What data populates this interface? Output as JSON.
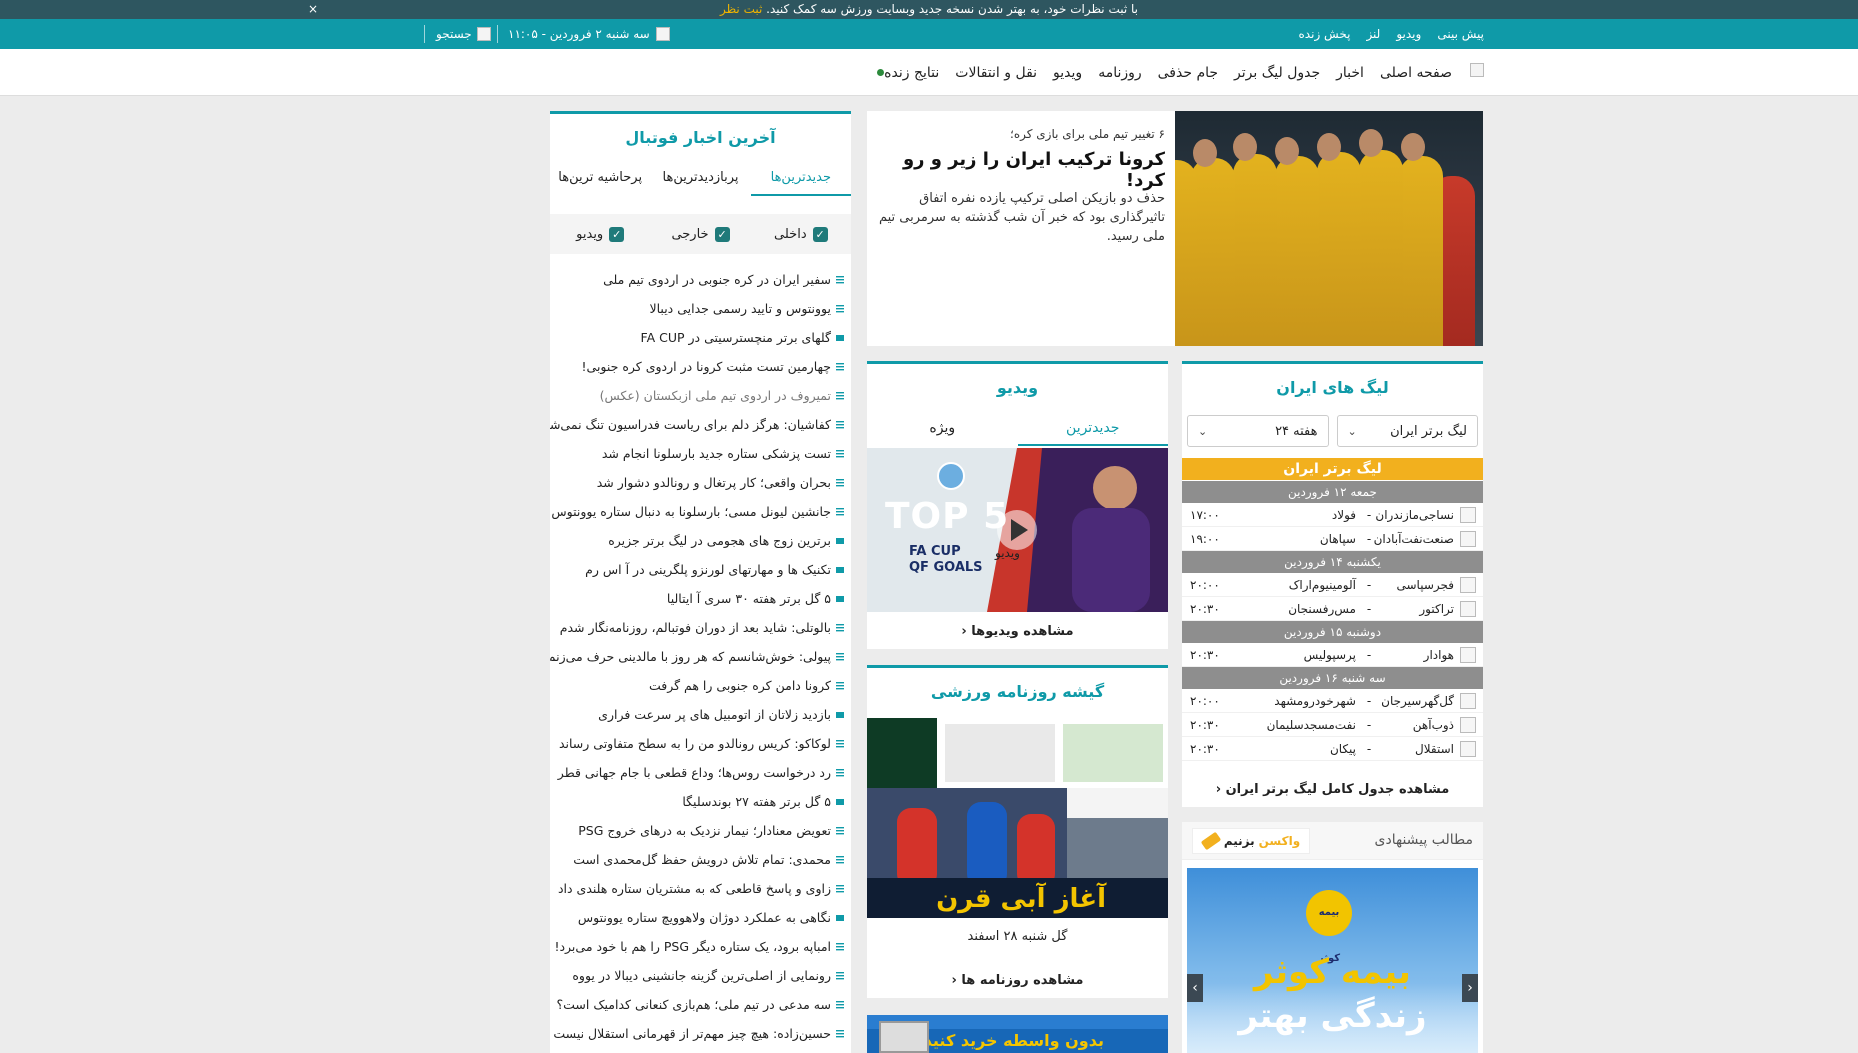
{
  "announce": {
    "text": "با ثبت نظرات خود، به بهتر شدن نسخه جدید وبسایت ورزش سه کمک کنید.",
    "cta": "ثبت نظر",
    "close": "×"
  },
  "topbar": {
    "links": [
      "پیش بینی",
      "ویدیو",
      "لنز",
      "پخش زنده"
    ],
    "date": "سه شنبه ۲ فروردین - ۱۱:۰۵",
    "search": "جستجو"
  },
  "nav": {
    "items": [
      "صفحه اصلی",
      "اخبار",
      "جدول لیگ برتر",
      "جام حذفی",
      "روزنامه",
      "ویدیو",
      "نقل و انتقالات",
      "نتایج زنده"
    ]
  },
  "hero": {
    "kicker": "۶ تغییر تیم ملی برای بازی کره؛",
    "title": "کرونا ترکیب ایران را زیر و رو کرد!",
    "lead": "حذف دو بازیکن اصلی ترکیپ یازده نفره اتفاق تاثیرگذاری بود که خبر آن شب گذشته به سرمربی تیم ملی رسید."
  },
  "league": {
    "title": "لیگ های ایران",
    "select_league": "لیگ برتر ایران",
    "select_week": "هفته ۲۴",
    "league_name": "لیگ برتر ایران",
    "days": [
      {
        "label": "جمعه ۱۲ فروردین",
        "matches": [
          {
            "home": "نساجی‌مازندران",
            "away": "فولاد",
            "time": "۱۷:۰۰"
          },
          {
            "home": "صنعت‌نفت‌آبادان",
            "away": "سپاهان",
            "time": "۱۹:۰۰"
          }
        ]
      },
      {
        "label": "یکشنبه ۱۴ فروردین",
        "matches": [
          {
            "home": "فجرسپاسی",
            "away": "آلومینیوم‌اراک",
            "time": "۲۰:۰۰"
          },
          {
            "home": "تراکتور",
            "away": "مس‌رفسنجان",
            "time": "۲۰:۳۰"
          }
        ]
      },
      {
        "label": "دوشنبه ۱۵ فروردین",
        "matches": [
          {
            "home": "هوادار",
            "away": "پرسپولیس",
            "time": "۲۰:۳۰"
          }
        ]
      },
      {
        "label": "سه شنبه ۱۶ فروردین",
        "matches": [
          {
            "home": "گل‌گهرسیرجان",
            "away": "شهرخودرومشهد",
            "time": "۲۰:۰۰"
          },
          {
            "home": "ذوب‌آهن",
            "away": "نفت‌مسجدسلیمان",
            "time": "۲۰:۳۰"
          },
          {
            "home": "استقلال",
            "away": "پیکان",
            "time": "۲۰:۳۰"
          }
        ]
      }
    ],
    "dash": "-",
    "more": "مشاهده جدول کامل لیگ برتر ایران"
  },
  "video": {
    "title": "ویدیو",
    "tabs": [
      "جدیدترین",
      "ویژه"
    ],
    "thumb_big": "TOP 5",
    "thumb_sub1": "FA CUP",
    "thumb_sub2": "QF GOALS",
    "thumb_play_label": "ویدیو",
    "more": "مشاهده ویدیوها"
  },
  "press": {
    "title": "گیشه روزنامه ورزشی",
    "headline": "آغاز آبی قرن",
    "caption": "گل شنبه ۲۸ اسفند",
    "more": "مشاهده روزنامه ها"
  },
  "adbottom": {
    "text": "بدون واسطه خرید کنید"
  },
  "suggest": {
    "title": "مطالب پیشنهادی",
    "brand_a": "واکسن",
    "brand_b": "بزنیم",
    "banner_line1": "بیمه کوثر",
    "banner_line2": "زندگی بهتر",
    "logo_text": "بیمه کوثر",
    "prev": "‹",
    "next": "›"
  },
  "latest": {
    "title": "آخرین اخبار فوتبال",
    "tabs": [
      "جدیدترین‌ها",
      "پربازدیدترین‌ها",
      "پرحاشیه ترین‌ها"
    ],
    "filters": [
      "داخلی",
      "خارجی",
      "ویدیو"
    ],
    "check": "✓",
    "items": [
      {
        "text": "سفیر ایران در کره جنوبی در اردوی تیم ملی",
        "type": "text"
      },
      {
        "text": "یوونتوس و تایید رسمی جدایی دیبالا",
        "type": "text"
      },
      {
        "text": "گلهای برتر منچسترسیتی در FA CUP",
        "type": "video"
      },
      {
        "text": "چهارمین تست مثبت کرونا در اردوی کره جنوبی!",
        "type": "text"
      },
      {
        "text": "تمیروف در اردوی تیم ملی ازبکستان (عکس)",
        "type": "text",
        "muted": true
      },
      {
        "text": "کفاشیان: هرگز دلم برای ریاست فدراسیون تنگ نمی‌شود",
        "type": "text"
      },
      {
        "text": "تست پزشکی ستاره جدید بارسلونا انجام شد",
        "type": "text"
      },
      {
        "text": "بحران واقعی؛ کار پرتغال و رونالدو دشوار شد",
        "type": "text"
      },
      {
        "text": "جانشین لیونل مسی؛ بارسلونا به دنبال ستاره یوونتوس",
        "type": "text"
      },
      {
        "text": "برترین زوج های هجومی در لیگ برتر جزیره",
        "type": "video"
      },
      {
        "text": "تکنیک ها و مهارتهای لورنزو پلگرینی در آ اس رم",
        "type": "video"
      },
      {
        "text": "۵ گل برتر هفته ۳۰ سری آ ایتالیا",
        "type": "video"
      },
      {
        "text": "بالوتلی: شاید بعد از دوران فوتبالم، روزنامه‌نگار شدم",
        "type": "text"
      },
      {
        "text": "پیولی: خوش‌شانسم که هر روز با مالدینی حرف می‌زنم",
        "type": "text"
      },
      {
        "text": "کرونا دامن کره جنوبی را هم گرفت",
        "type": "text"
      },
      {
        "text": "بازدید زلاتان از اتومبیل های پر سرعت فراری",
        "type": "video"
      },
      {
        "text": "لوکاکو: کریس رونالدو من را به سطح متفاوتی رساند",
        "type": "text"
      },
      {
        "text": "رد درخواست روس‌ها؛ وداع قطعی با جام جهانی قطر",
        "type": "text"
      },
      {
        "text": "۵ گل برتر هفته ۲۷ بوندسلیگا",
        "type": "video"
      },
      {
        "text": "تعویض معنادار؛ نیمار نزدیک به درهای خروج PSG",
        "type": "text"
      },
      {
        "text": "محمدی: تمام تلاش درویش حفظ گل‌محمدی است",
        "type": "text"
      },
      {
        "text": "زاوی و پاسخ قاطعی که به مشتریان ستاره هلندی داد",
        "type": "text"
      },
      {
        "text": "نگاهی به عملکرد دوژان ولاهوویچ ستاره یوونتوس",
        "type": "video"
      },
      {
        "text": "امباپه برود، یک ستاره دیگر PSG را هم با خود می‌برد!",
        "type": "text"
      },
      {
        "text": "رونمایی از اصلی‌ترین گزینه جانشینی دیبالا در یووه",
        "type": "text"
      },
      {
        "text": "سه مدعی در تیم ملی؛ هم‌بازی کنعانی کدامیک است؟",
        "type": "text"
      },
      {
        "text": "حسین‌زاده: هیچ چیز مهم‌تر از قهرمانی استقلال نیست",
        "type": "text"
      }
    ]
  },
  "colors": {
    "teal": "#0f9aa8",
    "dark": "#2e5660",
    "gold": "#f2b01e",
    "grey": "#8e8e8e"
  }
}
